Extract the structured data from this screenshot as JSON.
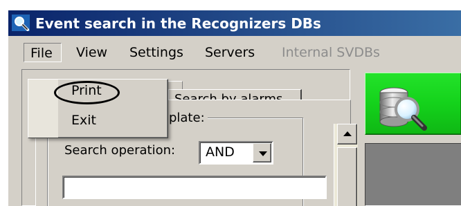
{
  "window": {
    "title": "Event search in the Recognizers DBs",
    "icon": "search-icon",
    "title_gradient": [
      "#0a246a",
      "#3a6ea5"
    ]
  },
  "menubar": {
    "items": [
      {
        "label": "File",
        "state": "open"
      },
      {
        "label": "View",
        "state": "enabled"
      },
      {
        "label": "Settings",
        "state": "enabled"
      },
      {
        "label": "Servers",
        "state": "enabled"
      },
      {
        "label": "Internal SVDBs",
        "state": "disabled"
      }
    ]
  },
  "file_menu": {
    "items": [
      {
        "label": "Print",
        "highlighted": true
      },
      {
        "label": "Exit",
        "highlighted": false
      }
    ]
  },
  "tabs": {
    "selected_partial_label": "Search by alarms"
  },
  "search_panel": {
    "group_label": "Vehicle's license plate:",
    "operation_label": "Search operation:",
    "operation_value": "AND",
    "license_plate_value": ""
  },
  "side_controls": {
    "search_button_icon": "database-search-icon",
    "search_button_color": "#16d11d",
    "display_color": "#7f7f7f"
  }
}
